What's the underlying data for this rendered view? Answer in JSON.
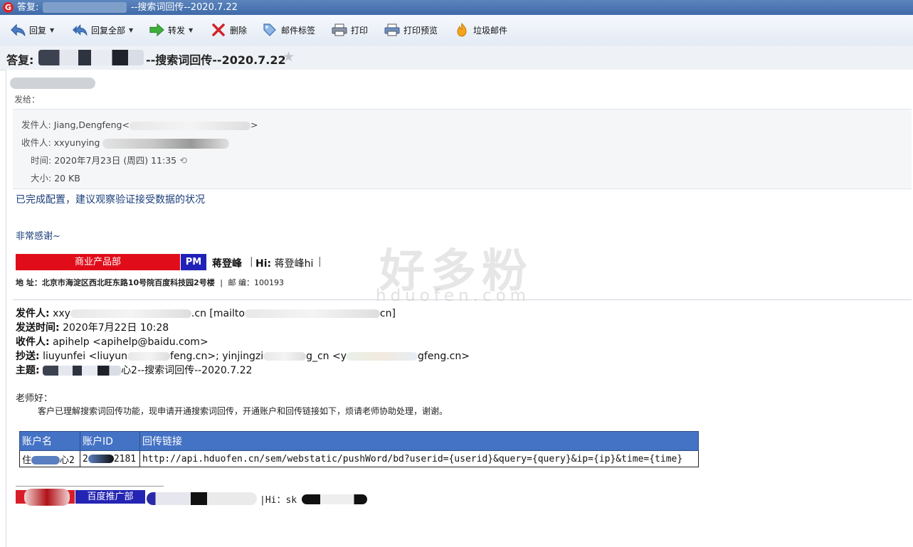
{
  "window": {
    "title_prefix": "答复:",
    "title_suffix": "--搜索词回传--2020.7.22"
  },
  "toolbar": {
    "reply": "回复",
    "reply_all": "回复全部",
    "forward": "转发",
    "delete": "删除",
    "tag": "邮件标签",
    "print": "打印",
    "print_preview": "打印预览",
    "junk": "垃圾邮件"
  },
  "subject": {
    "prefix": "答复:",
    "text": "--搜索词回传--2020.7.22"
  },
  "message": {
    "send_to_label": "发给：",
    "from_label": "发件人:",
    "from_value": "Jiang,Dengfeng",
    "from_open": "<",
    "from_close": ">",
    "to_label": "收件人:",
    "to_value": "xxyunying",
    "time_label": "时间:",
    "time_value": "2020年7月23日 (周四) 11:35",
    "size_label": "大小:",
    "size_value": "20 KB"
  },
  "reply_body": {
    "line1": "已完成配置，建议观察验证接受数据的状况",
    "line2": "非常感谢~"
  },
  "signature": {
    "dept": "商业产品部",
    "role": "PM",
    "name": "蒋登峰",
    "sep": "|",
    "hi_label": "Hi:",
    "hi_value": "蒋登峰hi",
    "address": "地  址：北京市海淀区西北旺东路10号院百度科技园2号楼",
    "postcode": "邮  编：100193"
  },
  "forwarded": {
    "from_label": "发件人:",
    "from_value": "xxy",
    "from_mid": ".cn [mailto",
    "from_end": "cn]",
    "sent_label": "发送时间:",
    "sent_value": "2020年7月22日 10:28",
    "to_label": "收件人:",
    "to_value": "apihelp <apihelp@baidu.com>",
    "cc_label": "抄送:",
    "cc_value1": "liuyunfei <liuyun",
    "cc_value2": "feng.cn>; yinjingzi",
    "cc_value3": "g_cn <y",
    "cc_value4": "gfeng.cn>",
    "subject_label": "主题:",
    "subject_mid": "心2--搜索词回传--2020.7.22"
  },
  "request": {
    "greeting": "老师好：",
    "body": "客户已理解搜索词回传功能，现申请开通搜索词回传，开通账户和回传链接如下，烦请老师协助处理，谢谢。"
  },
  "table": {
    "headers": [
      "账户名",
      "账户ID",
      "回传链接"
    ],
    "row": {
      "name_start": "住",
      "name_end": "心2",
      "id_start": "2",
      "id_end": "2181",
      "link": "http://api.hduofen.cn/sem/webstatic/pushWord/bd?userid={userid}&query={query}&ip={ip}&time={time}"
    }
  },
  "bottom_signature": {
    "dept": "百度推广部",
    "hi": "|Hi：sk"
  },
  "watermark": {
    "cn": "好多粉",
    "en": "hduofen.com"
  }
}
